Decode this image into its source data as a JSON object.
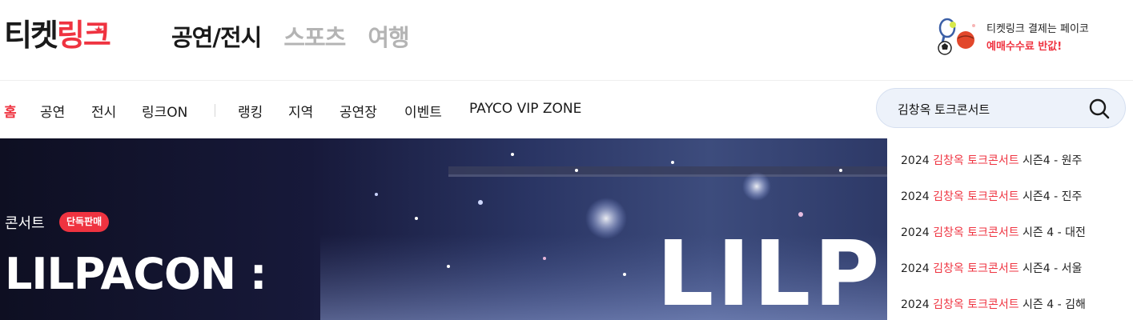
{
  "header": {
    "logo": {
      "part1": "티켓",
      "part2": "링크"
    },
    "main_tabs": [
      {
        "label": "공연/전시",
        "active": true
      },
      {
        "label": "스포츠",
        "active": false
      },
      {
        "label": "여행",
        "active": false
      }
    ],
    "promo": {
      "line1": "티켓링크 결제는 페이코",
      "line2": "예매수수료 반값!"
    }
  },
  "sub_nav": {
    "items": [
      {
        "label": "홈",
        "active": true
      },
      {
        "label": "공연"
      },
      {
        "label": "전시"
      },
      {
        "label": "링크ON"
      },
      {
        "label": "랭킹"
      },
      {
        "label": "지역"
      },
      {
        "label": "공연장"
      },
      {
        "label": "이벤트"
      },
      {
        "label": "PAYCO VIP ZONE"
      }
    ]
  },
  "search": {
    "value": "김창옥 토크콘서트"
  },
  "suggestions": [
    {
      "prefix": "2024 ",
      "highlight": "김창옥 토크콘서트",
      "suffix": " 시즌4 - 원주"
    },
    {
      "prefix": "2024 ",
      "highlight": "김창옥 토크콘서트",
      "suffix": " 시즌4 - 진주"
    },
    {
      "prefix": "2024 ",
      "highlight": "김창옥 토크콘서트",
      "suffix": " 시즌 4 - 대전"
    },
    {
      "prefix": "2024 ",
      "highlight": "김창옥 토크콘서트",
      "suffix": " 시즌4 - 서울"
    },
    {
      "prefix": "2024 ",
      "highlight": "김창옥 토크콘서트",
      "suffix": " 시즌 4 - 김해"
    }
  ],
  "hero": {
    "category": "콘서트",
    "badge": "단독판매",
    "title": "LILPACON :",
    "art_text": "LILP"
  },
  "colors": {
    "accent": "#ef3340",
    "search_bg": "#edf2fa"
  }
}
